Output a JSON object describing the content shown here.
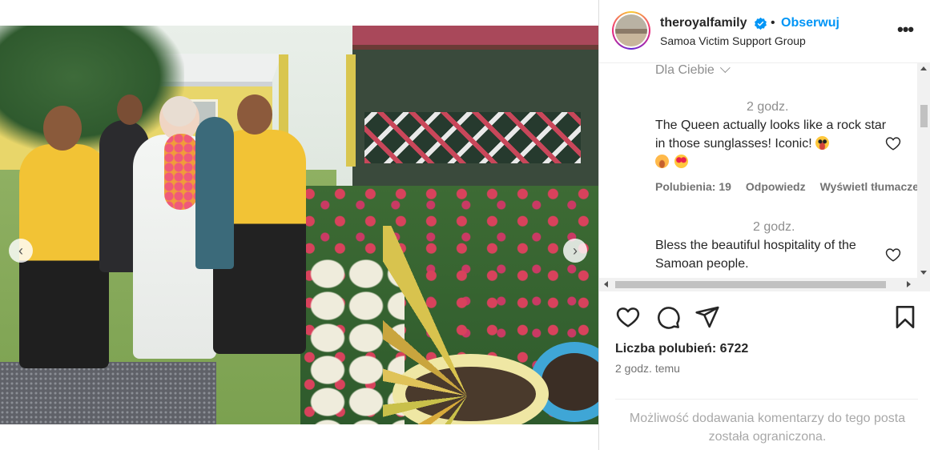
{
  "header": {
    "username": "theroyalfamily",
    "separator": "•",
    "follow_label": "Obserwuj",
    "location": "Samoa Victim Support Group",
    "more_label": "•••",
    "verified_icon": "verified-badge-icon",
    "verified_color": "#0095f6"
  },
  "media": {
    "prev_label": "‹",
    "next_label": "›",
    "carousel_dots": 5,
    "active_dot": 3
  },
  "comments": {
    "sort_label": "Dla Ciebie",
    "items": [
      {
        "time": "2 godz.",
        "text": "The Queen actually looks like a rock star in those sunglasses! Iconic!",
        "emojis": [
          "zany-face-emoji",
          "hugging-face-emoji",
          "heart-eyes-emoji"
        ],
        "likes_label": "Polubienia: 19",
        "reply_label": "Odpowiedz",
        "translate_label": "Wyświetl tłumaczenie"
      },
      {
        "time": "2 godz.",
        "text": "Bless the beautiful hospitality of the Samoan people."
      }
    ]
  },
  "actions": {
    "like_icon": "heart-icon",
    "comment_icon": "comment-icon",
    "share_icon": "send-icon",
    "save_icon": "bookmark-icon"
  },
  "likes_text": "Liczba polubień: 6722",
  "post_time": "2 godz. temu",
  "restricted_text": "Możliwość dodawania komentarzy do tego posta została ograniczona.",
  "colors": {
    "accent": "#0095f6",
    "text": "#262626",
    "muted": "#737373"
  }
}
